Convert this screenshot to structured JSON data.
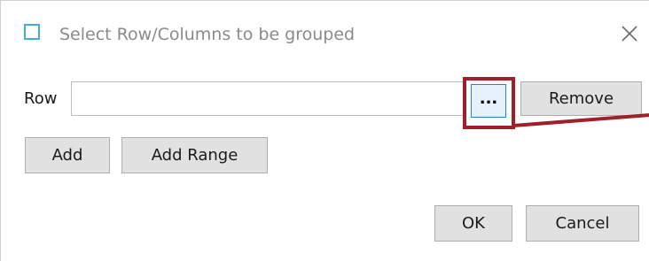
{
  "dialog": {
    "title": "Select Row/Columns to be grouped",
    "icon": "app-window-icon",
    "close_icon": "close-icon"
  },
  "row": {
    "label": "Row",
    "value": "",
    "placeholder": "",
    "browse_label": "...",
    "remove_label": "Remove"
  },
  "actions": {
    "add_label": "Add",
    "add_range_label": "Add Range"
  },
  "footer": {
    "ok_label": "OK",
    "cancel_label": "Cancel"
  },
  "colors": {
    "highlight": "#a0202a",
    "icon_accent": "#3bb3c9",
    "focus_border": "#2a7fd4"
  }
}
